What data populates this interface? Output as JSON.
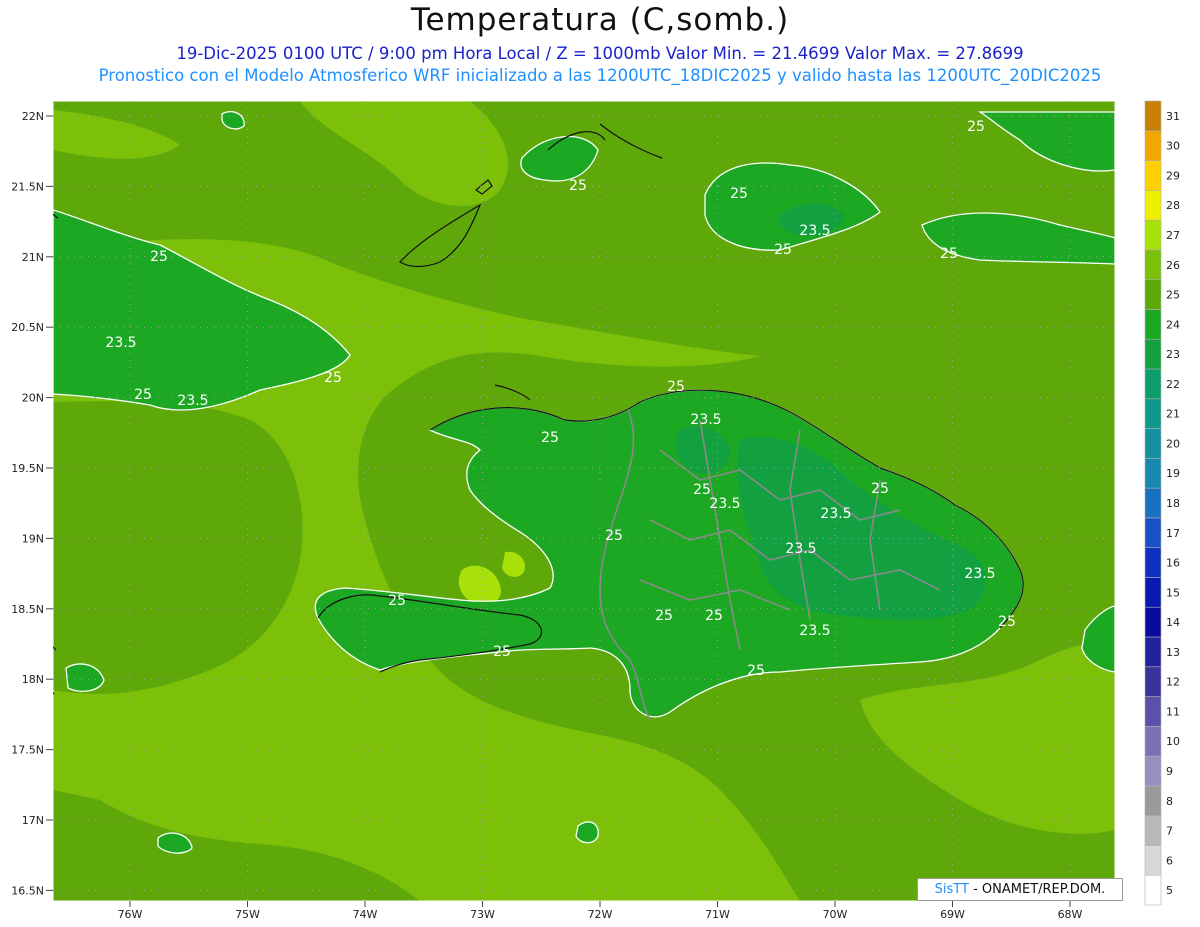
{
  "header": {
    "title": "Temperatura (C,somb.)",
    "line1": "19-Dic-2025  0100 UTC / 9:00 pm Hora Local / Z = 1000mb   Valor Min. = 21.4699  Valor Max. = 27.8699",
    "line2": "Pronostico con el Modelo Atmosferico WRF inicializado a las 1200UTC_18DIC2025 y valido hasta las  1200UTC_20DIC2025"
  },
  "axes": {
    "lat_labels": [
      "22N",
      "21.5N",
      "21N",
      "20.5N",
      "20N",
      "19.5N",
      "19N",
      "18.5N",
      "18N",
      "17.5N",
      "17N",
      "16.5N"
    ],
    "lon_labels": [
      "76W",
      "75W",
      "74W",
      "73W",
      "72W",
      "71W",
      "70W",
      "69W",
      "68W"
    ]
  },
  "legend": {
    "levels": [
      "5",
      "6",
      "7",
      "8",
      "9",
      "10",
      "11",
      "12",
      "13",
      "14",
      "15",
      "16",
      "17",
      "18",
      "19",
      "20",
      "21",
      "22",
      "23",
      "24",
      "25",
      "26",
      "27",
      "28",
      "29",
      "30",
      "31"
    ],
    "colors": [
      "#ffffff",
      "#d8d8d8",
      "#b8b8b8",
      "#9a9a9a",
      "#9a8ec0",
      "#7a72b4",
      "#5a52aa",
      "#3a329a",
      "#22229a",
      "#0a0a9e",
      "#0a1ab0",
      "#1030c0",
      "#1a50c8",
      "#1a70c0",
      "#1888b0",
      "#14909e",
      "#10988a",
      "#0c9e6a",
      "#12a040",
      "#1da824",
      "#5ea80a",
      "#7cc00a",
      "#a8e00a",
      "#eef000",
      "#ffd000",
      "#f0a800",
      "#c88000"
    ]
  },
  "contours": {
    "values": [
      "25",
      "23.5"
    ]
  },
  "credit": {
    "brand": "SisTT",
    "org": " - ONAMET/REP.DOM."
  }
}
